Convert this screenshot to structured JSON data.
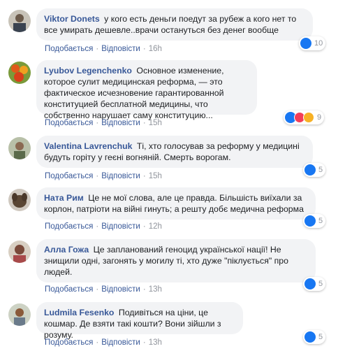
{
  "colors": {
    "author": "#385898",
    "bubble": "#f2f3f5",
    "meta": "#90949c",
    "like": "#1877f2"
  },
  "comments": [
    {
      "author": "Viktor Donets",
      "text": "у кого есть деньги поедут за рубеж а кого нет то все умирать дешевле..врачи остануться без денег вообще",
      "like": "Подобається",
      "reply": "Відповісти",
      "time": "16h",
      "reaction_count": "10",
      "reactions": [
        "like-icon"
      ]
    },
    {
      "author": "Lyubov Legenchenko",
      "text": "Основное изменение, которое сулит медицинская реформа, — это фактическое исчезновение гарантированной конституцией бесплатной медицины, что собственно нарушает саму конституцию...",
      "like": "Подобається",
      "reply": "Відповісти",
      "time": "15h",
      "reaction_count": "9",
      "reactions": [
        "like-icon",
        "love-icon",
        "sad-icon"
      ]
    },
    {
      "author": "Valentina Lavrenchuk",
      "text": "Ті, хто голосував за реформу у медицині будуть горіту у геєні вогняній. Смерть ворогам.",
      "like": "Подобається",
      "reply": "Відповісти",
      "time": "15h",
      "reaction_count": "5",
      "reactions": [
        "like-icon"
      ]
    },
    {
      "author": "Ната Рим",
      "text": "Це не мої слова, але це правда. Більшість виїхали за корлон, патріоти на війні гинуть; а решту добє медична реформа",
      "like": "Подобається",
      "reply": "Відповісти",
      "time": "12h",
      "reaction_count": "5",
      "reactions": [
        "like-icon"
      ]
    },
    {
      "author": "Алла Гожа",
      "text": "Це запланований геноцид української нації! Не знищили одні, загонять у могилу ті, хто дуже \"піклується\" про людей.",
      "like": "Подобається",
      "reply": "Відповісти",
      "time": "13h",
      "reaction_count": "5",
      "reactions": [
        "like-icon"
      ]
    },
    {
      "author": "Ludmila Fesenko",
      "text": "Подивіться на ціни, це кошмар. Де взяти такі кошти? Вони зійшли з розуму.",
      "like": "Подобається",
      "reply": "Відповісти",
      "time": "13h",
      "reaction_count": "5",
      "reactions": [
        "like-icon"
      ]
    }
  ]
}
